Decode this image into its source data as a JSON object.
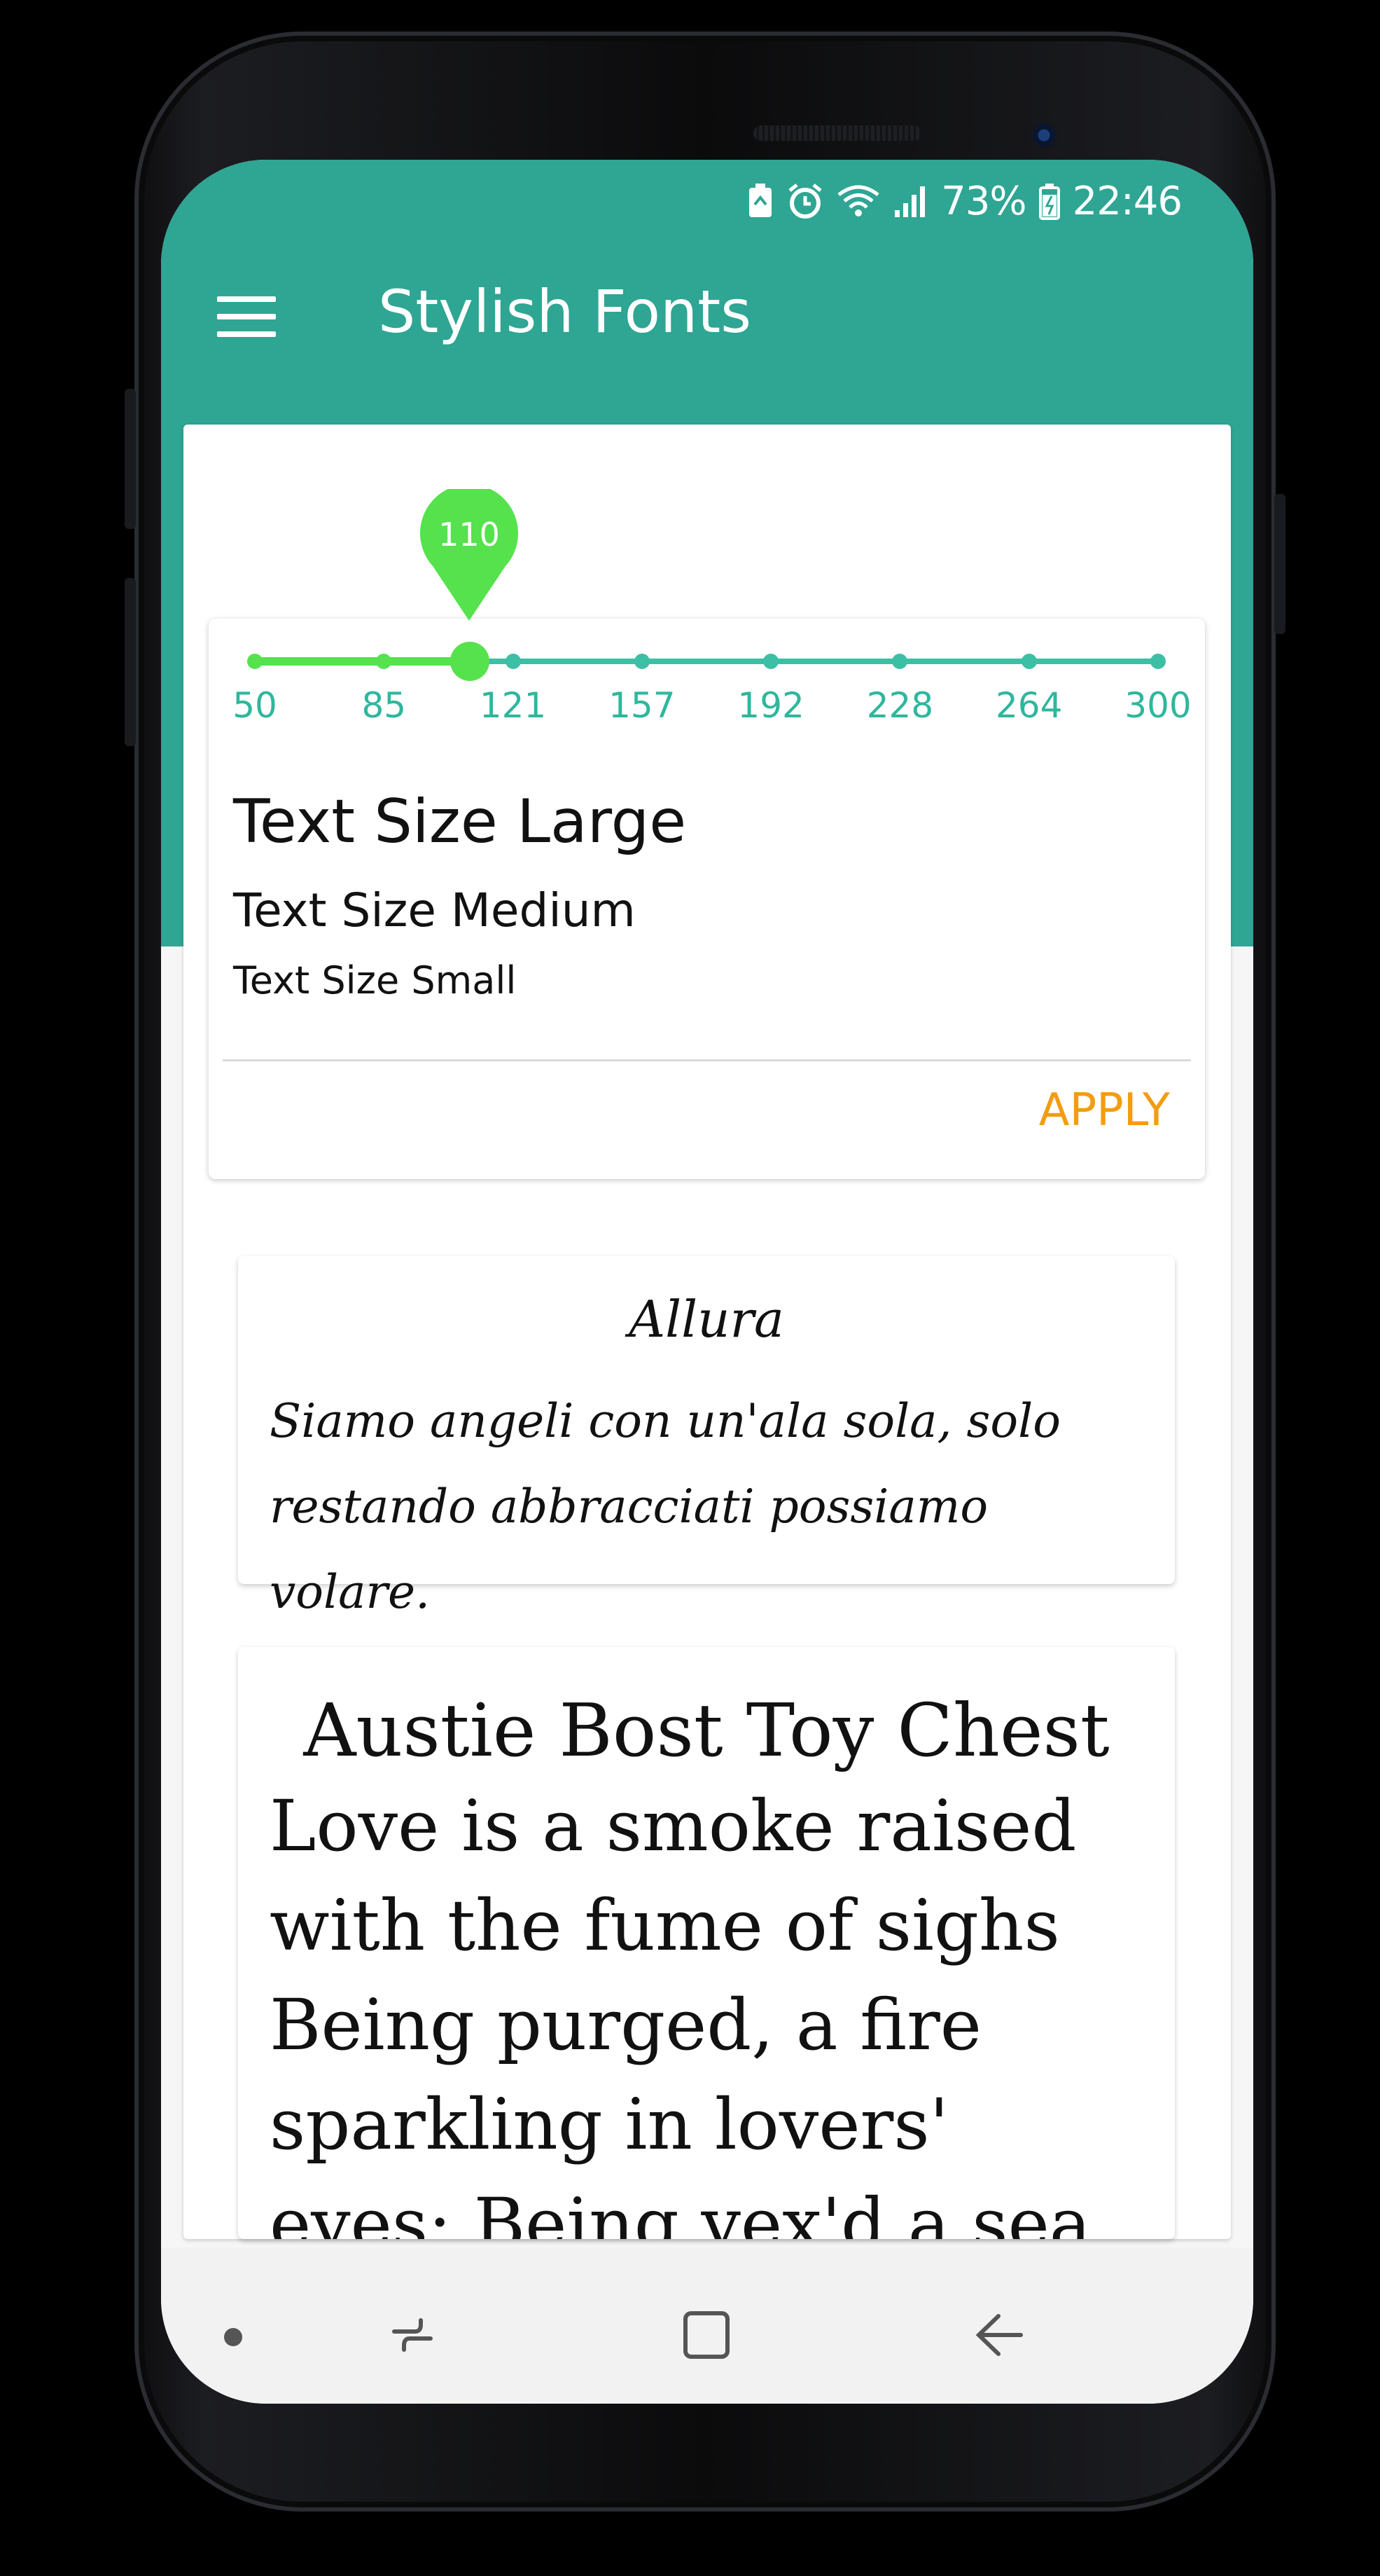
{
  "status_bar": {
    "icons": [
      "battery-saver-icon",
      "alarm-icon",
      "wifi-icon",
      "signal-icon",
      "battery-icon"
    ],
    "battery_percent": "73%",
    "time": "22:46"
  },
  "app_bar": {
    "title": "Stylish Fonts",
    "menu_icon": "hamburger-menu-icon"
  },
  "slider": {
    "current_value": "110",
    "min": 50,
    "max": 300,
    "ticks": [
      "50",
      "85",
      "121",
      "157",
      "192",
      "228",
      "264",
      "300"
    ],
    "fill_fraction": 0.24
  },
  "preview": {
    "large": "Text Size Large",
    "medium": "Text Size Medium",
    "small": "Text Size Small",
    "apply_label": "APPLY"
  },
  "fonts": [
    {
      "name": "Allura",
      "sample": "Siamo angeli con un'ala sola, solo restando abbracciati possiamo volare."
    },
    {
      "name": "Austie Bost Toy Chest",
      "sample": "Love is a smoke raised with the fume of sighs Being purged, a fire sparkling in lovers' eyes; Being vex'd a sea"
    }
  ],
  "nav_bar": {
    "icons": [
      "nav-dot-icon",
      "recents-icon",
      "home-icon",
      "back-icon"
    ]
  },
  "colors": {
    "primary": "#2fa593",
    "accent_green": "#55e24d",
    "track_teal": "#3dbfa6",
    "apply_orange": "#f39c12"
  }
}
